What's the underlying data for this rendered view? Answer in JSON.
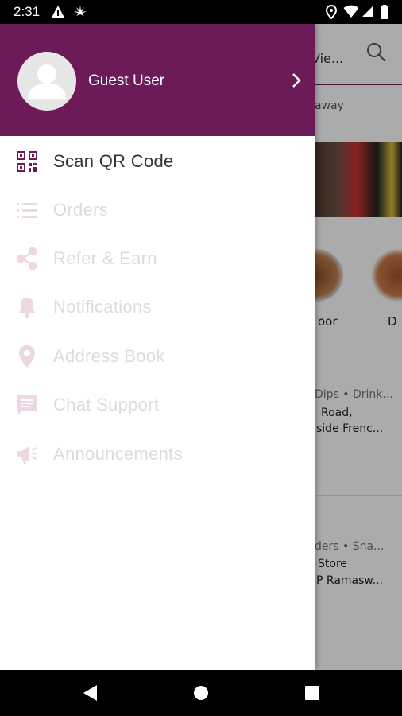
{
  "status_bar": {
    "time": "2:31",
    "icons": [
      "warning-icon",
      "cannabis-icon",
      "location-icon",
      "wifi-icon",
      "signal-icon",
      "battery-icon"
    ]
  },
  "background_app": {
    "tab_label": "Vie...",
    "subtitle": "away",
    "category_label_1": "oor",
    "category_label_2": "D",
    "store_1": {
      "tags": "Dips • Drink...",
      "line1": "Road,",
      "line2": "side Frenc..."
    },
    "store_2": {
      "tags": "ders • Sna...",
      "line1": "Store",
      "line2": "P Ramasw..."
    }
  },
  "drawer": {
    "user_name": "Guest User",
    "accent_color": "#6d1b58",
    "menu_items": [
      {
        "label": "Scan QR Code",
        "icon": "qr-code-icon",
        "enabled": true
      },
      {
        "label": "Orders",
        "icon": "list-icon",
        "enabled": false
      },
      {
        "label": "Refer & Earn",
        "icon": "share-icon",
        "enabled": false
      },
      {
        "label": "Notifications",
        "icon": "bell-icon",
        "enabled": false
      },
      {
        "label": "Address Book",
        "icon": "location-pin-icon",
        "enabled": false
      },
      {
        "label": "Chat Support",
        "icon": "chat-icon",
        "enabled": false
      },
      {
        "label": "Announcements",
        "icon": "megaphone-icon",
        "enabled": false
      }
    ]
  },
  "nav_bar": {
    "buttons": [
      "back-icon",
      "home-icon",
      "recents-icon"
    ]
  }
}
